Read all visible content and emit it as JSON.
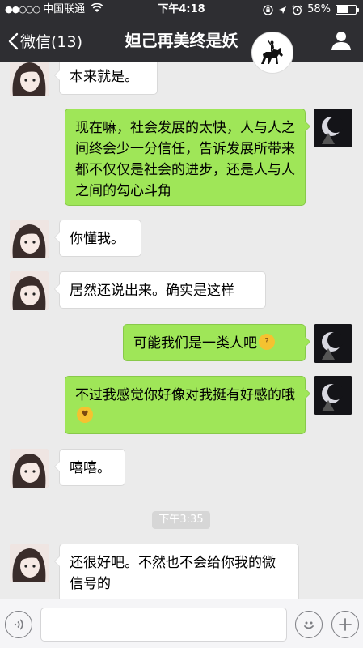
{
  "status_bar": {
    "signal_dots": "●●○○○",
    "carrier": "中国联通",
    "wifi_icon": "wifi-icon",
    "time": "下午4:18",
    "battery_percent": "58%",
    "battery_level": 0.58
  },
  "nav": {
    "back_label": "微信(13)",
    "title": "妲己再美终是妖",
    "profile_icon": "person-icon"
  },
  "messages": [
    {
      "side": "in",
      "text": "本来就是。"
    },
    {
      "side": "out",
      "text": "现在嘛，社会发展的太快，人与人之间终会少一分信任，告诉发展所带来都不仅仅是社会的进步，还是人与人之间的勾心斗角"
    },
    {
      "side": "in",
      "text": "你懂我。"
    },
    {
      "side": "in",
      "text": "居然还说出来。确实是这样"
    },
    {
      "side": "out",
      "text": "可能我们是一类人吧"
    },
    {
      "side": "out",
      "text": "不过我感觉你好像对我挺有好感的哦"
    },
    {
      "side": "in",
      "text": "嘻嘻。"
    },
    {
      "side": "in",
      "text": "还很好吧。不然也不会给你我的微信号的"
    }
  ],
  "timestamp": "下午3:35",
  "input": {
    "placeholder": ""
  },
  "colors": {
    "nav_bg": "#2e2e32",
    "chat_bg": "#ebebeb",
    "bubble_out": "#9fe658",
    "bubble_in": "#ffffff"
  }
}
